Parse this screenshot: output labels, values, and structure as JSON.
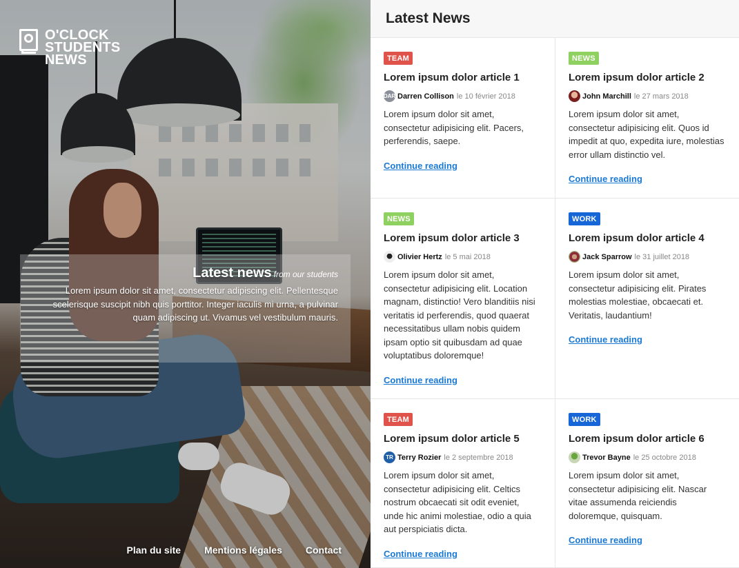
{
  "brand": {
    "line1": "O'CLOCK",
    "line2": "STUDENTS",
    "line3": "NEWS"
  },
  "hero": {
    "title": "Latest news",
    "subtitle": "from our students",
    "text": "Lorem ipsum dolor sit amet, consectetur adipiscing elit. Pellentesque scelerisque suscipit nibh quis porttitor. Integer iaculis mi urna, a pulvinar quam adipiscing ut. Vivamus vel vestibulum mauris."
  },
  "footer": {
    "links": [
      "Plan du site",
      "Mentions légales",
      "Contact"
    ]
  },
  "main": {
    "title": "Latest News"
  },
  "articles": [
    {
      "category": "TEAM",
      "title": "Lorem ipsum dolor article 1",
      "author": "Darren Collison",
      "avatar_initials": "DAR",
      "date": "le 10 février 2018",
      "excerpt": "Lorem ipsum dolor sit amet, consectetur adipisicing elit. Pacers, perferendis, saepe.",
      "link": "Continue reading"
    },
    {
      "category": "NEWS",
      "title": "Lorem ipsum dolor article 2",
      "author": "John Marchill",
      "avatar_initials": "",
      "date": "le 27 mars 2018",
      "excerpt": "Lorem ipsum dolor sit amet, consectetur adipisicing elit. Quos id impedit at quo, expedita iure, molestias error ullam distinctio vel.",
      "link": "Continue reading"
    },
    {
      "category": "NEWS",
      "title": "Lorem ipsum dolor article 3",
      "author": "Olivier Hertz",
      "avatar_initials": "",
      "date": "le 5 mai 2018",
      "excerpt": "Lorem ipsum dolor sit amet, consectetur adipisicing elit. Location magnam, distinctio! Vero blanditiis nisi veritatis id perferendis, quod quaerat necessitatibus ullam nobis quidem ipsam optio sit quibusdam ad quae voluptatibus doloremque!",
      "link": "Continue reading"
    },
    {
      "category": "WORK",
      "title": "Lorem ipsum dolor article 4",
      "author": "Jack Sparrow",
      "avatar_initials": "",
      "date": "le 31 juillet 2018",
      "excerpt": "Lorem ipsum dolor sit amet, consectetur adipisicing elit. Pirates molestias molestiae, obcaecati et. Veritatis, laudantium!",
      "link": "Continue reading"
    },
    {
      "category": "TEAM",
      "title": "Lorem ipsum dolor article 5",
      "author": "Terry Rozier",
      "avatar_initials": "TR",
      "date": "le 2 septembre 2018",
      "excerpt": "Lorem ipsum dolor sit amet, consectetur adipisicing elit. Celtics nostrum obcaecati sit odit eveniet, unde hic animi molestiae, odio a quia aut perspiciatis dicta.",
      "link": "Continue reading"
    },
    {
      "category": "WORK",
      "title": "Lorem ipsum dolor article 6",
      "author": "Trevor Bayne",
      "avatar_initials": "",
      "date": "le 25 octobre 2018",
      "excerpt": "Lorem ipsum dolor sit amet, consectetur adipisicing elit. Nascar vitae assumenda reiciendis doloremque, quisquam.",
      "link": "Continue reading"
    }
  ],
  "colors": {
    "team": "#e0534a",
    "news": "#8fd160",
    "work": "#1766d8",
    "link": "#1a79d3"
  }
}
